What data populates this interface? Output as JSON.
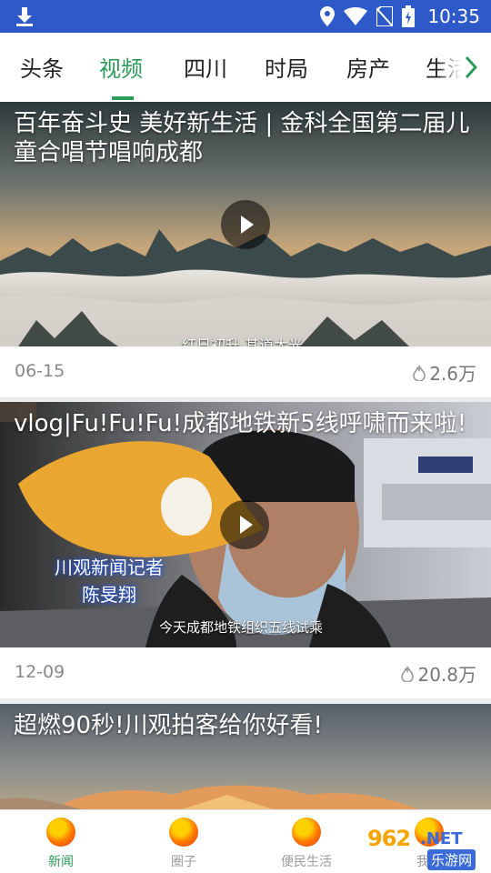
{
  "status_bar": {
    "time": "10:35",
    "icons": [
      "download-icon",
      "location-icon",
      "wifi-icon",
      "no-sim-icon",
      "battery-charging-icon"
    ]
  },
  "tabs": [
    {
      "label": "头条",
      "active": false
    },
    {
      "label": "视频",
      "active": true
    },
    {
      "label": "四川",
      "active": false
    },
    {
      "label": "时局",
      "active": false
    },
    {
      "label": "房产",
      "active": false
    },
    {
      "label": "生活",
      "active": false
    }
  ],
  "feed": [
    {
      "title": "百年奋斗史 美好新生活 | 金科全国第二届儿童合唱节唱响成都",
      "caption": "红日初升 其道大光",
      "date": "06-15",
      "views": "2.6万"
    },
    {
      "title": "vlog|Fu!Fu!Fu!成都地铁新5线呼啸而来啦!",
      "overlay_name": "川观新闻记者",
      "overlay_name2": "陈旻翔",
      "caption": "今天成都地铁组织五线试乘",
      "date": "12-09",
      "views": "20.8万"
    },
    {
      "title": "超燃90秒!川观拍客给你好看!"
    }
  ],
  "bottom_nav": [
    {
      "label": "新闻",
      "active": true
    },
    {
      "label": "圈子",
      "active": false
    },
    {
      "label": "便民生活",
      "active": false
    },
    {
      "label": "我的",
      "active": false
    }
  ],
  "watermark": {
    "number": "962",
    "suffix": ".NET",
    "site": "乐游网"
  },
  "colors": {
    "status_bar": "#2e59c9",
    "accent": "#2b9b5a"
  }
}
